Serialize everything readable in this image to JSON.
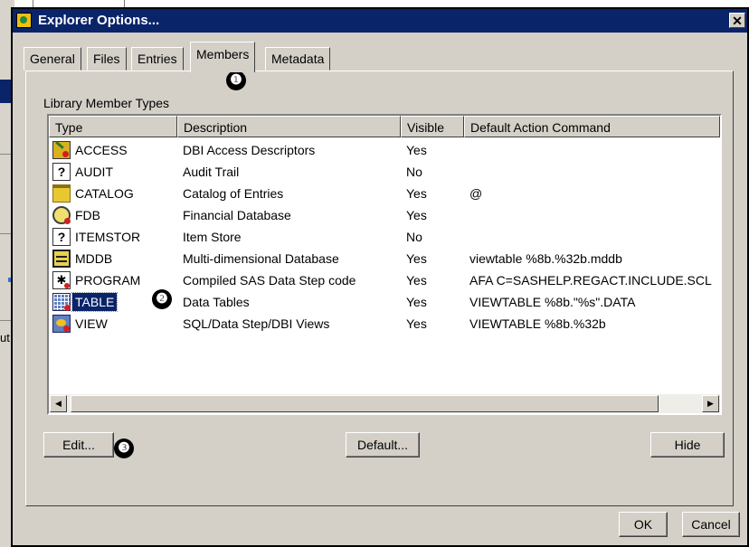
{
  "background": {
    "left_fragment_text": "ut"
  },
  "dialog": {
    "title": "Explorer Options...",
    "close_glyph": "✕"
  },
  "tabs": [
    {
      "label": "General"
    },
    {
      "label": "Files"
    },
    {
      "label": "Entries"
    },
    {
      "label": "Members",
      "active": true
    },
    {
      "label": "Metadata"
    }
  ],
  "group_label": "Library Member Types",
  "columns": [
    "Type",
    "Description",
    "Visible",
    "Default Action Command"
  ],
  "rows": [
    {
      "type": "ACCESS",
      "icon": "access-icon",
      "description": "DBI Access Descriptors",
      "visible": "Yes",
      "command": ""
    },
    {
      "type": "AUDIT",
      "icon": "unknown-icon",
      "description": "Audit Trail",
      "visible": "No",
      "command": ""
    },
    {
      "type": "CATALOG",
      "icon": "folder-icon",
      "description": "Catalog of Entries",
      "visible": "Yes",
      "command": "@"
    },
    {
      "type": "FDB",
      "icon": "fdb-icon",
      "description": "Financial Database",
      "visible": "Yes",
      "command": ""
    },
    {
      "type": "ITEMSTOR",
      "icon": "unknown-icon",
      "description": "Item Store",
      "visible": "No",
      "command": ""
    },
    {
      "type": "MDDB",
      "icon": "mddb-icon",
      "description": "Multi-dimensional Database",
      "visible": "Yes",
      "command": "viewtable %8b.%32b.mddb"
    },
    {
      "type": "PROGRAM",
      "icon": "program-icon",
      "description": "Compiled SAS Data Step code",
      "visible": "Yes",
      "command": "AFA C=SASHELP.REGACT.INCLUDE.SCL"
    },
    {
      "type": "TABLE",
      "icon": "table-icon",
      "description": "Data Tables",
      "visible": "Yes",
      "command": "VIEWTABLE %8b.\"%s\".DATA",
      "selected": true
    },
    {
      "type": "VIEW",
      "icon": "view-icon",
      "description": "SQL/Data Step/DBI Views",
      "visible": "Yes",
      "command": "VIEWTABLE %8b.%32b"
    }
  ],
  "buttons": {
    "edit": "Edit...",
    "default": "Default...",
    "hide": "Hide",
    "ok": "OK",
    "cancel": "Cancel"
  },
  "callouts": [
    "❶",
    "❷",
    "❸"
  ],
  "glyphs": {
    "question": "?",
    "program": "✱",
    "scroll_left": "◀",
    "scroll_right": "▶"
  }
}
